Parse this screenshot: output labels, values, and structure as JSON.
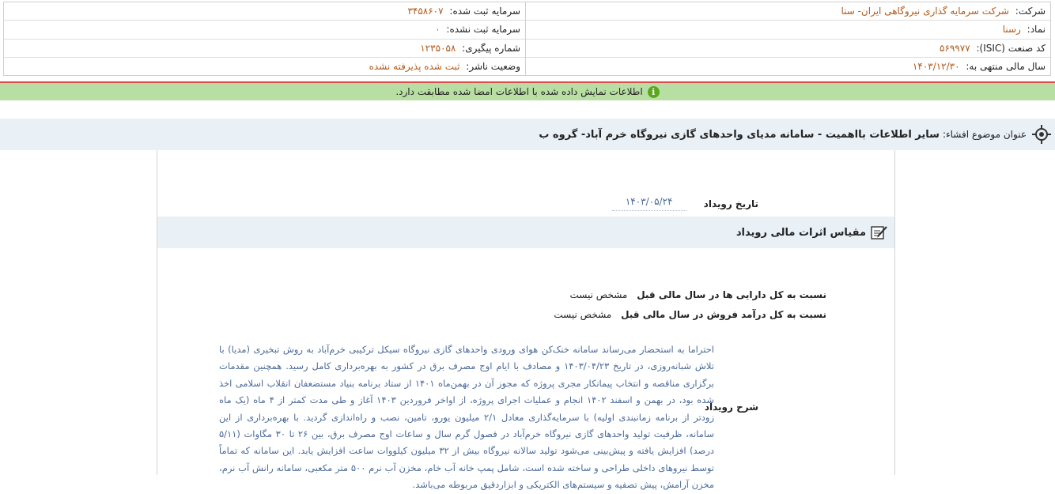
{
  "header": {
    "company_label": "شرکت:",
    "company_value": "شرکت سرمایه گذاری نیروگاهی ایران- سنا",
    "symbol_label": "نماد:",
    "symbol_value": "رسنا",
    "isic_label": "کد صنعت (ISIC):",
    "isic_value": "۵۶۹۹۷۷",
    "fiscal_label": "سال مالی منتهی به:",
    "fiscal_value": "۱۴۰۳/۱۲/۳۰",
    "registered_capital_label": "سرمایه ثبت شده:",
    "registered_capital_value": "۳۴۵۸۶۰۷",
    "unregistered_capital_label": "سرمایه ثبت نشده:",
    "unregistered_capital_value": "۰",
    "tracking_label": "شماره پیگیری:",
    "tracking_value": "۱۲۳۵۰۵۸",
    "publisher_status_label": "وضعیت ناشر:",
    "publisher_status_value": "ثبت شده پذیرفته نشده"
  },
  "message": "اطلاعات نمایش داده شده با اطلاعات امضا شده مطابقت دارد.",
  "subject": {
    "label": "عنوان موضوع افشاء:",
    "title": "سایر اطلاعات بااهمیت - سامانه مدیای واحدهای گازی نیروگاه خرم آباد- گروه ب"
  },
  "event": {
    "date_label": "تاریخ رویداد",
    "date_value": "۱۴۰۳/۰۵/۲۴",
    "section_title": "مقیاس اثرات مالی رویداد",
    "ratio_assets_label": "نسبت به کل دارایی ها در سال مالی قبل",
    "ratio_assets_value": "مشخص نیست",
    "ratio_sales_label": "نسبت به کل درآمد فروش در سال مالی قبل",
    "ratio_sales_value": "مشخص نیست",
    "description_label": "شرح رویداد",
    "description_text": "احتراما به استحضار می‌رساند سامانه خنک‌کن هوای ورودی واحدهای گازی نیروگاه سیکل ترکیبی خرم‌آباد به روش تبخیری (مدیا) با تلاش شبانه‌روزی، در تاریخ ۱۴۰۳/۰۴/۲۳ و مصادف با ایام اوج مصرف برق در کشور به بهره‌برداری کامل رسید. همچنین مقدمات برگزاری مناقصه و انتخاب پیمانکار مجری پروژه که مجوز آن در بهمن‌ماه ۱۴۰۱ از ستاد برنامه بنیاد مستضعفان انقلاب اسلامی اخذ شده بود، در بهمن و اسفند ۱۴۰۲ انجام و عملیات اجرای پروژه، از اواخر فروردین ۱۴۰۳ آغاز و طی مدت کمتر از ۴ ماه (یک ماه زودتر از برنامه زمانبندی اولیه) با سرمایه‌گذاری معادل ۲/۱ میلیون یورو، تامین، نصب و راه‌اندازی گردید. با بهره‌برداری از این سامانه، ظرفیت تولید واحدهای گازی نیروگاه خرم‌آباد در فصول گرم سال و ساعات اوج مصرف برق، بین ۲۶ تا ۳۰ مگاوات (۵/۱۱ درصد) افزایش یافته و پیش‌بینی می‌شود تولید سالانه نیروگاه بیش از ۳۲ میلیون کیلووات ساعت افزایش یابد. این سامانه که تماماً توسط نیروهای داخلی طراحی و ساخته شده است، شامل پمپ خانه آب خام، مخزن آب نرم ۵۰۰ متر مکعبی، سامانه رانش آب نرم، مخزن آرامش، پیش تصفیه و سیستم‌های الکتریکی و ابزاردقیق مربوطه می‌باشد."
  },
  "colors": {
    "value_orange": "#b05a1b",
    "msg_green": "#b9dea4",
    "section_blue": "#e9f0f6",
    "desc_blue": "#4a6a9a",
    "red_line": "#e04a4a"
  },
  "icons": {
    "info": "info-circle-icon",
    "subject": "target-icon",
    "section": "edit-note-icon"
  }
}
